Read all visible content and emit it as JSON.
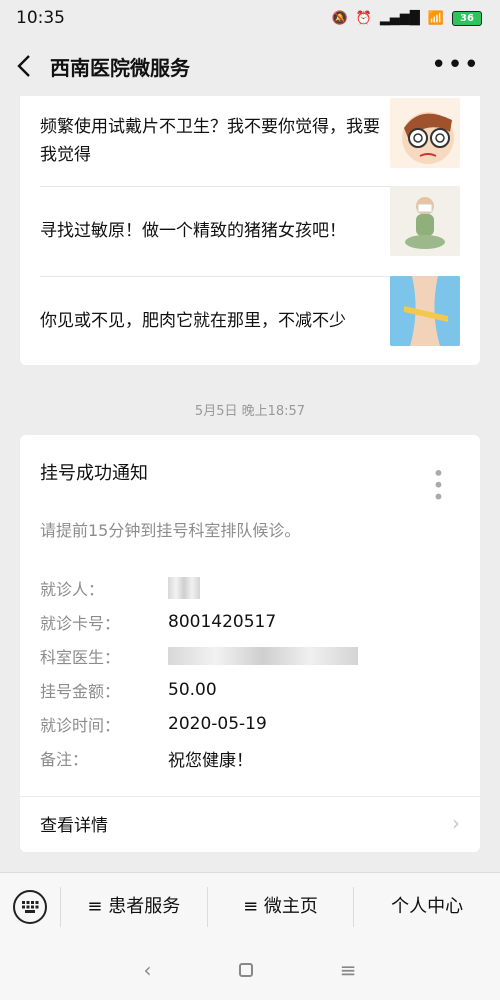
{
  "status_bar": {
    "time": "10:35",
    "battery": "36"
  },
  "nav": {
    "title": "西南医院微服务"
  },
  "articles": [
    {
      "text": "频繁使用试戴片不卫生？我不要你觉得，我要我觉得",
      "thumb": "cartoon-face-icon"
    },
    {
      "text": "寻找过敏原！做一个精致的猪猪女孩吧！",
      "thumb": "sneezing-woman-icon"
    },
    {
      "text": "你见或不见，肥肉它就在那里，不减不少",
      "thumb": "waist-measure-icon"
    }
  ],
  "timestamp": "5月5日 晚上18:57",
  "notice": {
    "title": "挂号成功通知",
    "subtitle": "请提前15分钟到挂号科室排队候诊。",
    "fields": [
      {
        "label": "就诊人：",
        "value": ""
      },
      {
        "label": "就诊卡号：",
        "value": "8001420517"
      },
      {
        "label": "科室医生：",
        "value": ""
      },
      {
        "label": "挂号金额：",
        "value": "50.00"
      },
      {
        "label": "就诊时间：",
        "value": "2020-05-19"
      },
      {
        "label": "备注：",
        "value": "祝您健康！"
      }
    ],
    "detail_link": "查看详情"
  },
  "bottom_menu": {
    "items": [
      "≡ 患者服务",
      "≡ 微主页",
      "个人中心"
    ]
  }
}
